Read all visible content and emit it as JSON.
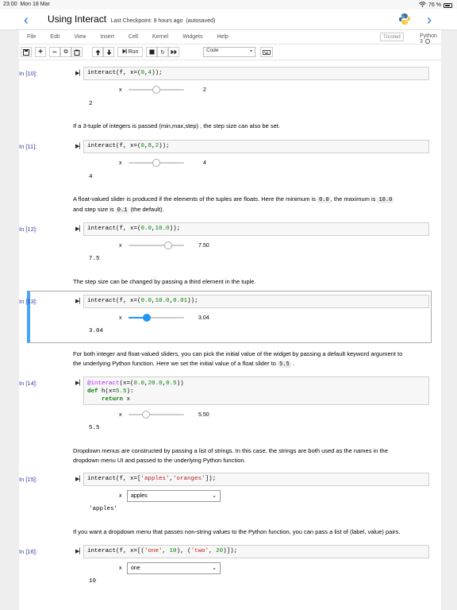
{
  "status": {
    "time": "23:00",
    "date": "Mon 18 Mar",
    "battery": "76 %"
  },
  "header": {
    "title": "Using Interact",
    "checkpoint": "Last Checkpoint: 9 hours ago",
    "autosaved": "(autosaved)"
  },
  "menu": [
    "File",
    "Edit",
    "View",
    "Insert",
    "Cell",
    "Kernel",
    "Widgets",
    "Help"
  ],
  "trusted": "Trusted",
  "kernel": "Python 3",
  "toolbar": {
    "run_label": "Run",
    "cell_type": "Code"
  },
  "cells": {
    "c10": {
      "prompt": "In [10]:",
      "output": "2",
      "label": "x",
      "value": "2"
    },
    "md1": "If a 3-tuple of integers is passed (min,max,step) , the step size can also be set.",
    "c11": {
      "prompt": "In [11]:",
      "output": "4",
      "label": "x",
      "value": "4"
    },
    "md2a": "A float-valued slider is produced if the elements of the tuples are floats. Here the minimum is",
    "md2b": "0.0",
    "md2c": ", the maximum is",
    "md2d": "10.0",
    "md2e": "and step size is",
    "md2f": "0.1",
    "md2g": "(the default).",
    "c12": {
      "prompt": "In [12]:",
      "output": "7.5",
      "label": "x",
      "value": "7.50"
    },
    "md3": "The step size can be changed by passing a third element in the tuple.",
    "c13": {
      "prompt": "In [13]:",
      "output": "3.04",
      "label": "x",
      "value": "3.04"
    },
    "md4a": "For both integer and float-valued sliders, you can pick the initial value of the widget by passing a default keyword argument to",
    "md4b": "the underlying Python function. Here we set the initial value of a float slider to",
    "md4c": "5.5",
    "c14": {
      "prompt": "In [14]:",
      "output": "5.5",
      "label": "x",
      "value": "5.50"
    },
    "md5a": "Dropdown menus are constructed by passing a list of strings. In this case, the strings are both used as the names in the",
    "md5b": "dropdown menu UI and passed to the underlying Python function.",
    "c15": {
      "prompt": "In [15]:",
      "output": "'apples'",
      "label": "x",
      "selected": "apples"
    },
    "md6": "If you want a dropdown menu that passes non-string values to the Python function, you can pass a list of (label, value) pairs.",
    "c16": {
      "prompt": "In [16]:",
      "output": "10",
      "label": "x",
      "selected": "one"
    }
  },
  "sliders": {
    "c10": 0.5,
    "c11": 0.5,
    "c12": 0.75,
    "c13": 0.304,
    "c14": 0.275
  },
  "colors": {
    "accent": "#1e7be0",
    "selected_cell": "#42a5f5",
    "prompt": "#303f9f"
  }
}
